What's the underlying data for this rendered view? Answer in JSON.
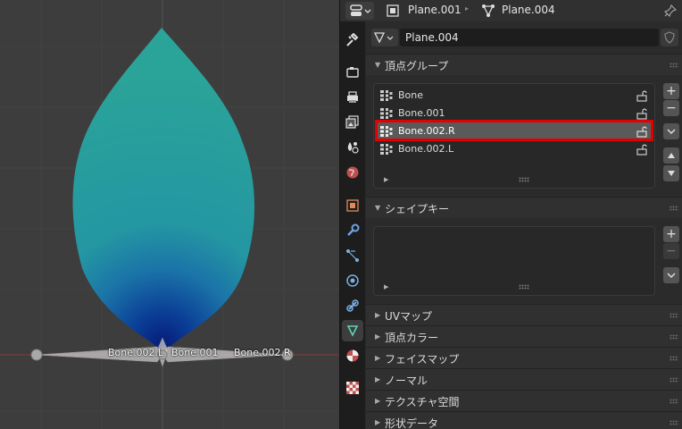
{
  "viewport": {
    "bones": [
      {
        "name": "bone-label-002-l",
        "label": "Bone.002.L"
      },
      {
        "name": "bone-label-001",
        "label": "Bone.001"
      },
      {
        "name": "bone-label-002-r",
        "label": "Bone.002.R"
      }
    ],
    "colors": {
      "background": "#3d3d3d",
      "mesh_top": "#2aa39a",
      "mesh_bottom": "#0a2f8f",
      "axis": "#8a3b3b"
    }
  },
  "header": {
    "object_name": "Plane.001",
    "mesh_name": "Plane.004"
  },
  "mesh_datablock": {
    "name": "Plane.004"
  },
  "vertex_groups": {
    "title": "頂点グループ",
    "items": [
      {
        "label": "Bone"
      },
      {
        "label": "Bone.001"
      },
      {
        "label": "Bone.002.R"
      },
      {
        "label": "Bone.002.L"
      }
    ],
    "selected_index": 2
  },
  "shape_keys": {
    "title": "シェイプキー"
  },
  "collapsed_panels": [
    {
      "title": "UVマップ"
    },
    {
      "title": "頂点カラー"
    },
    {
      "title": "フェイスマップ"
    },
    {
      "title": "ノーマル"
    },
    {
      "title": "テクスチャ空間"
    },
    {
      "title": "形状データ"
    }
  ],
  "buttons": {
    "add": "+",
    "remove": "−"
  },
  "colors": {
    "highlight": "#e30000",
    "selected_row": "#5a5a5a",
    "active_tab_icon": "#5fd3b5"
  }
}
